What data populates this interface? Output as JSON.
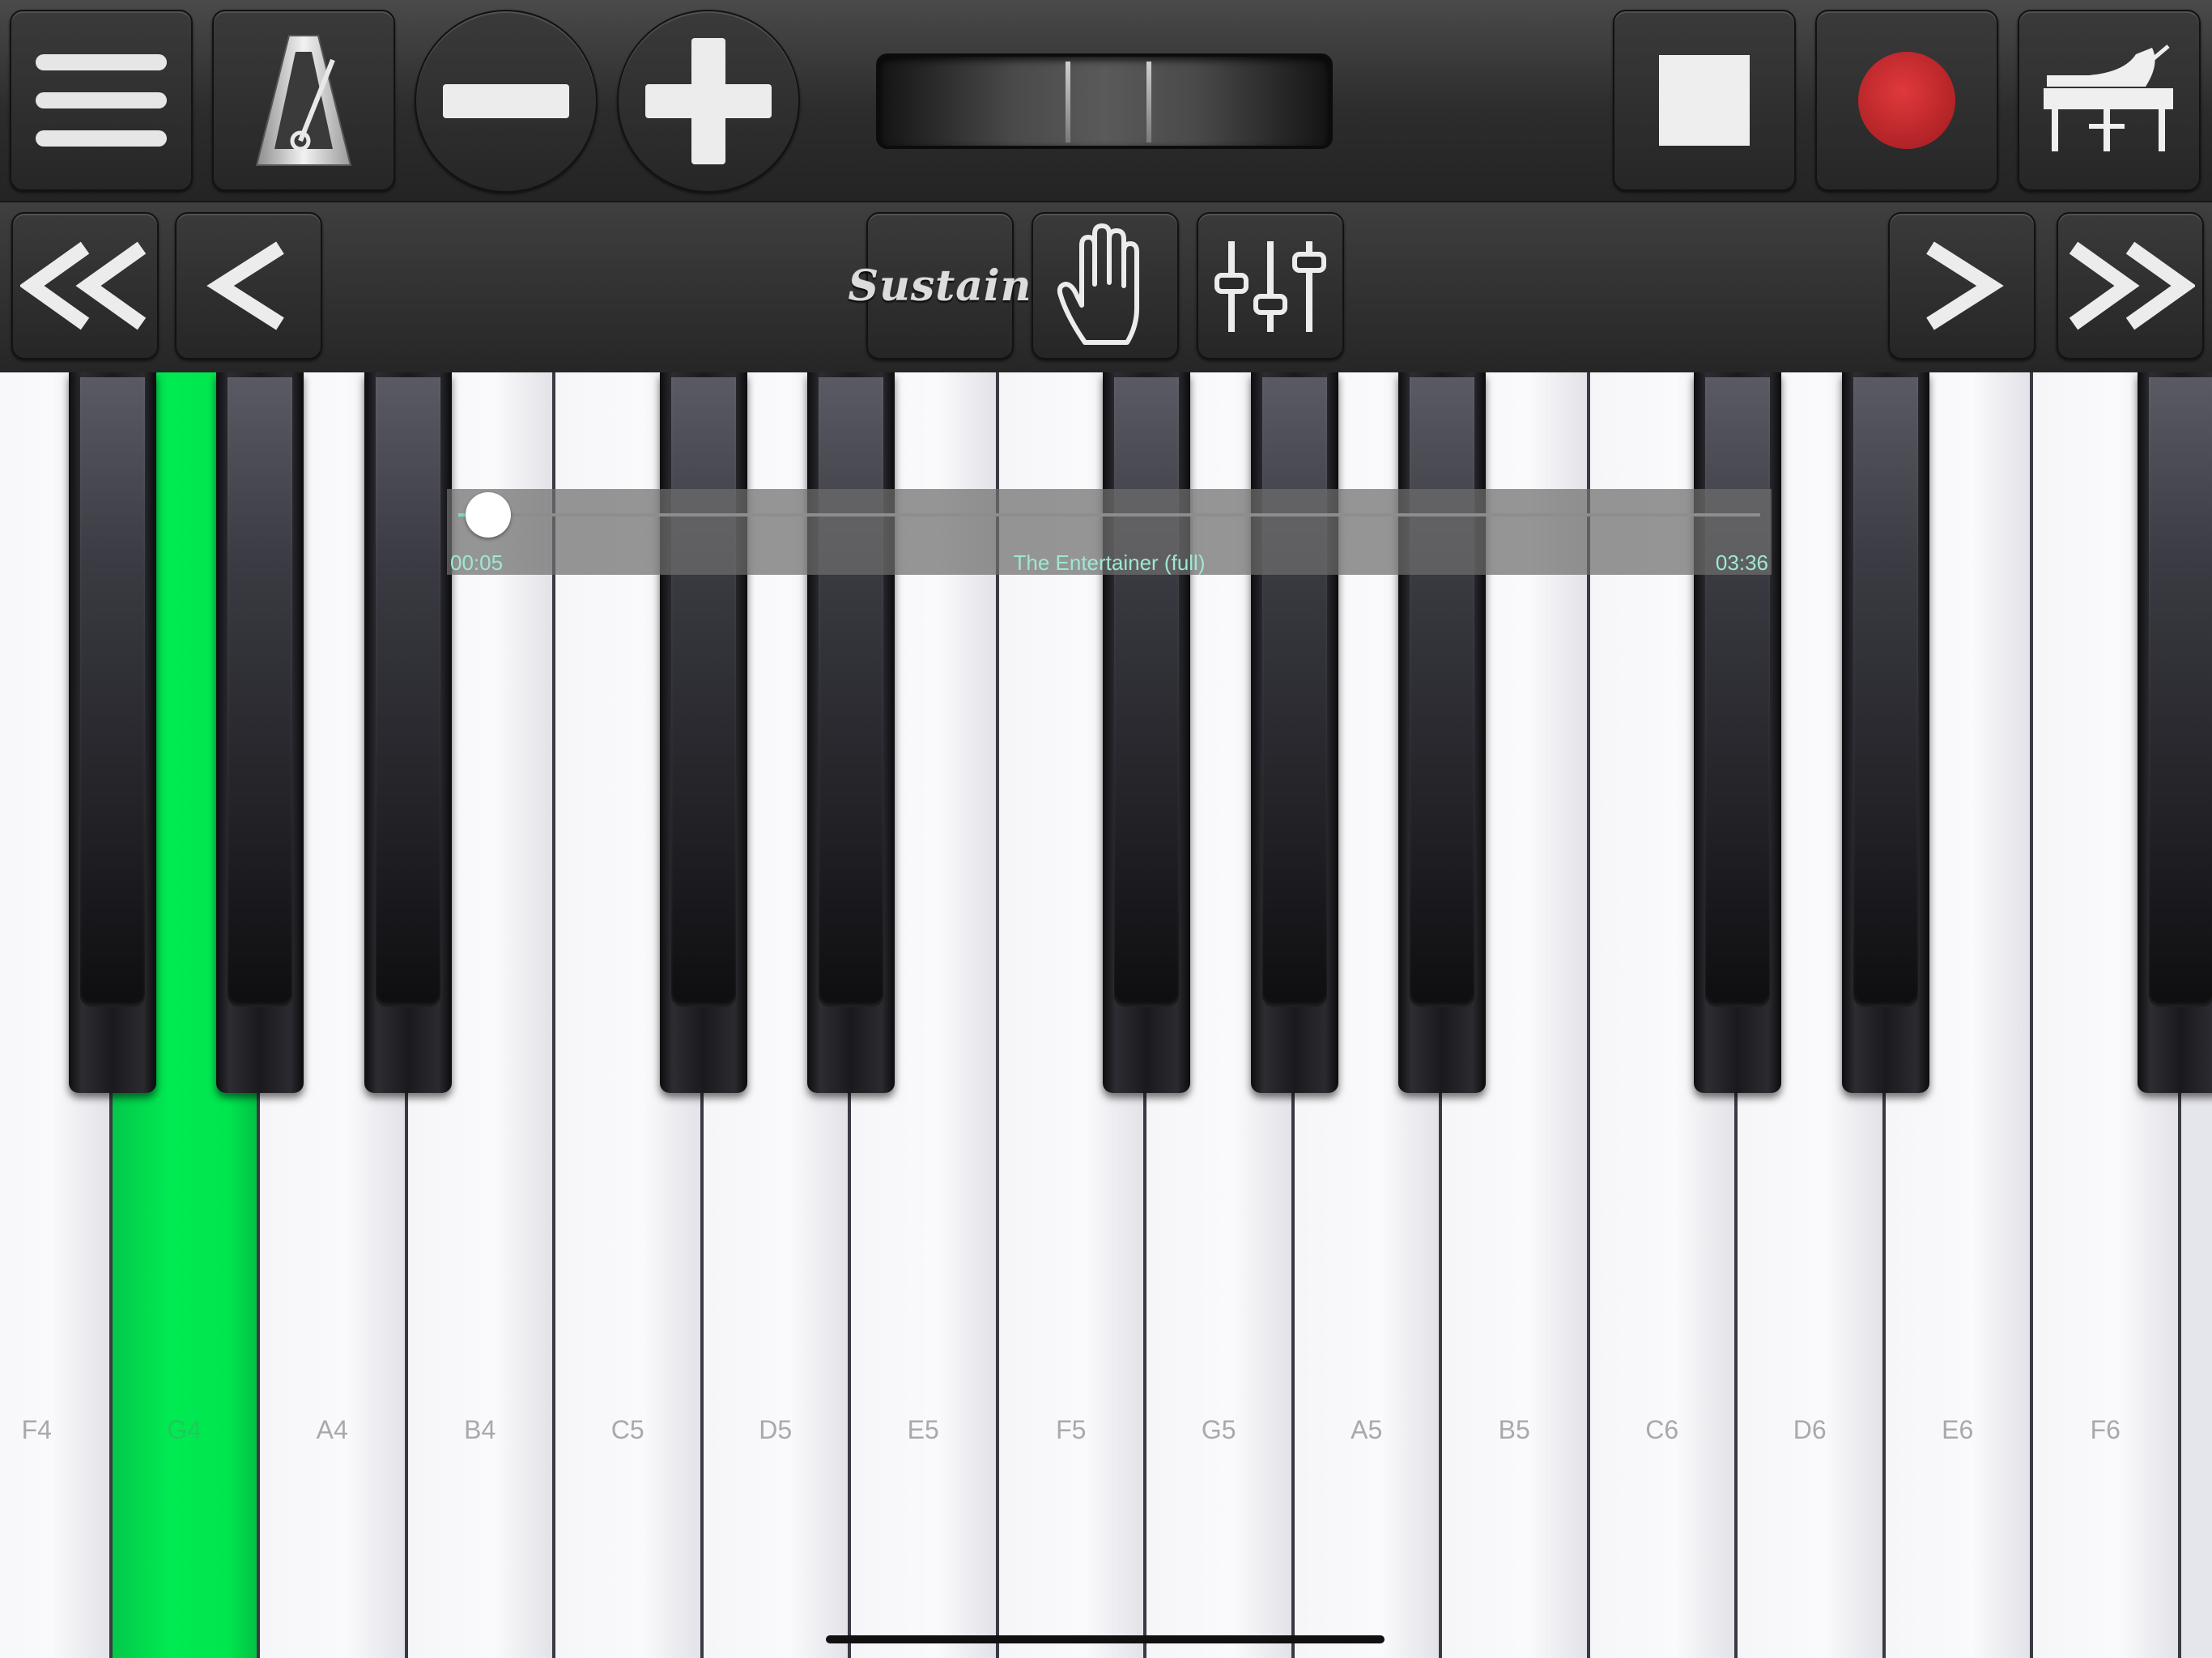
{
  "toolbar": {
    "menu_icon": "hamburger-menu-icon",
    "metronome_icon": "metronome-icon",
    "decrease_icon": "minus-icon",
    "increase_icon": "plus-icon",
    "stop_icon": "stop-icon",
    "record_icon": "record-icon",
    "instrument_icon": "grand-piano-icon"
  },
  "nav": {
    "sustain_label": "Sustain",
    "hand_icon": "hand-icon",
    "mixer_icon": "mixer-sliders-icon",
    "scroll_left_far_icon": "double-chevron-left-icon",
    "scroll_left_icon": "chevron-left-icon",
    "scroll_right_icon": "chevron-right-icon",
    "scroll_right_far_icon": "double-chevron-right-icon"
  },
  "player": {
    "song_title": "The Entertainer (full)",
    "elapsed": "00:05",
    "total": "03:36",
    "progress_fraction": 0.023
  },
  "keyboard": {
    "white_keys": [
      "F4",
      "G4",
      "A4",
      "B4",
      "C5",
      "D5",
      "E5",
      "F5",
      "G5",
      "A5",
      "B5",
      "C6",
      "D6",
      "E6",
      "F6"
    ],
    "active_key": "G4",
    "black_key_names": [
      "F#4",
      "G#4",
      "A#4",
      "C#5",
      "D#5",
      "F#5",
      "G#5",
      "A#5",
      "C#6",
      "D#6",
      "F#6"
    ]
  },
  "colors": {
    "active_key": "#00e64f",
    "record": "#c4282c",
    "progress_accent": "#7fd8c2"
  }
}
